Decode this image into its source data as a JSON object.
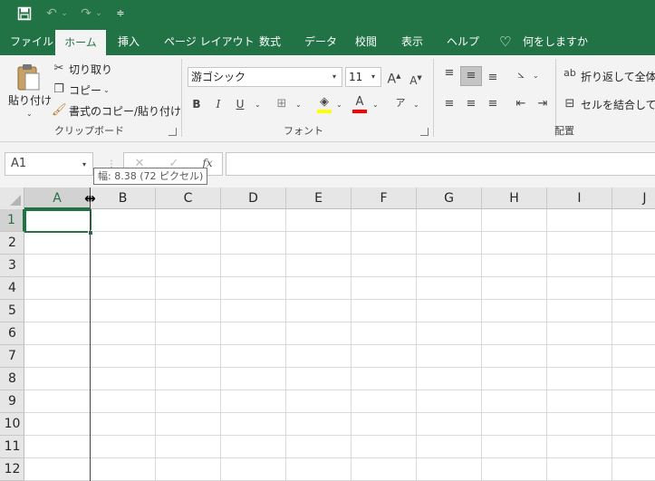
{
  "quick_access": {
    "save_icon": "save-icon",
    "undo_icon": "undo-icon",
    "redo_icon": "redo-icon",
    "customize_icon": "customize-qat-icon"
  },
  "tabs": [
    {
      "label": "ファイル"
    },
    {
      "label": "ホーム",
      "active": true
    },
    {
      "label": "挿入"
    },
    {
      "label": "ページ レイアウト"
    },
    {
      "label": "数式"
    },
    {
      "label": "データ"
    },
    {
      "label": "校閲"
    },
    {
      "label": "表示"
    },
    {
      "label": "ヘルプ"
    }
  ],
  "tell_me": {
    "label": "何をしますか",
    "icon": "lightbulb-icon"
  },
  "clipboard": {
    "paste_label": "貼り付け",
    "cut_label": "切り取り",
    "copy_label": "コピー",
    "format_painter_label": "書式のコピー/貼り付け",
    "group_label": "クリップボード"
  },
  "font": {
    "family": "游ゴシック",
    "size": "11",
    "bold": "B",
    "italic": "I",
    "underline": "U",
    "grow_icon": "font-grow-icon",
    "shrink_icon": "font-shrink-icon",
    "group_label": "フォント",
    "font_color": "#ff0000",
    "fill_color": "#ffff00"
  },
  "alignment": {
    "wrap_text_label": "折り返して全体を",
    "merge_label": "セルを結合して中",
    "group_label": "配置"
  },
  "formula_bar": {
    "name_box": "A1",
    "fx": "fx",
    "cancel_icon": "cancel-icon",
    "enter_icon": "check-icon"
  },
  "tooltip": "幅: 8.38 (72 ピクセル)",
  "columns": [
    "A",
    "B",
    "C",
    "D",
    "E",
    "F",
    "G",
    "H",
    "I",
    "J"
  ],
  "rows": [
    "1",
    "2",
    "3",
    "4",
    "5",
    "6",
    "7",
    "8",
    "9",
    "10",
    "11",
    "12"
  ],
  "active_cell": "A1",
  "colors": {
    "accent": "#217346",
    "ribbon_bg": "#f3f3f3",
    "header_bg": "#e6e6e6"
  }
}
